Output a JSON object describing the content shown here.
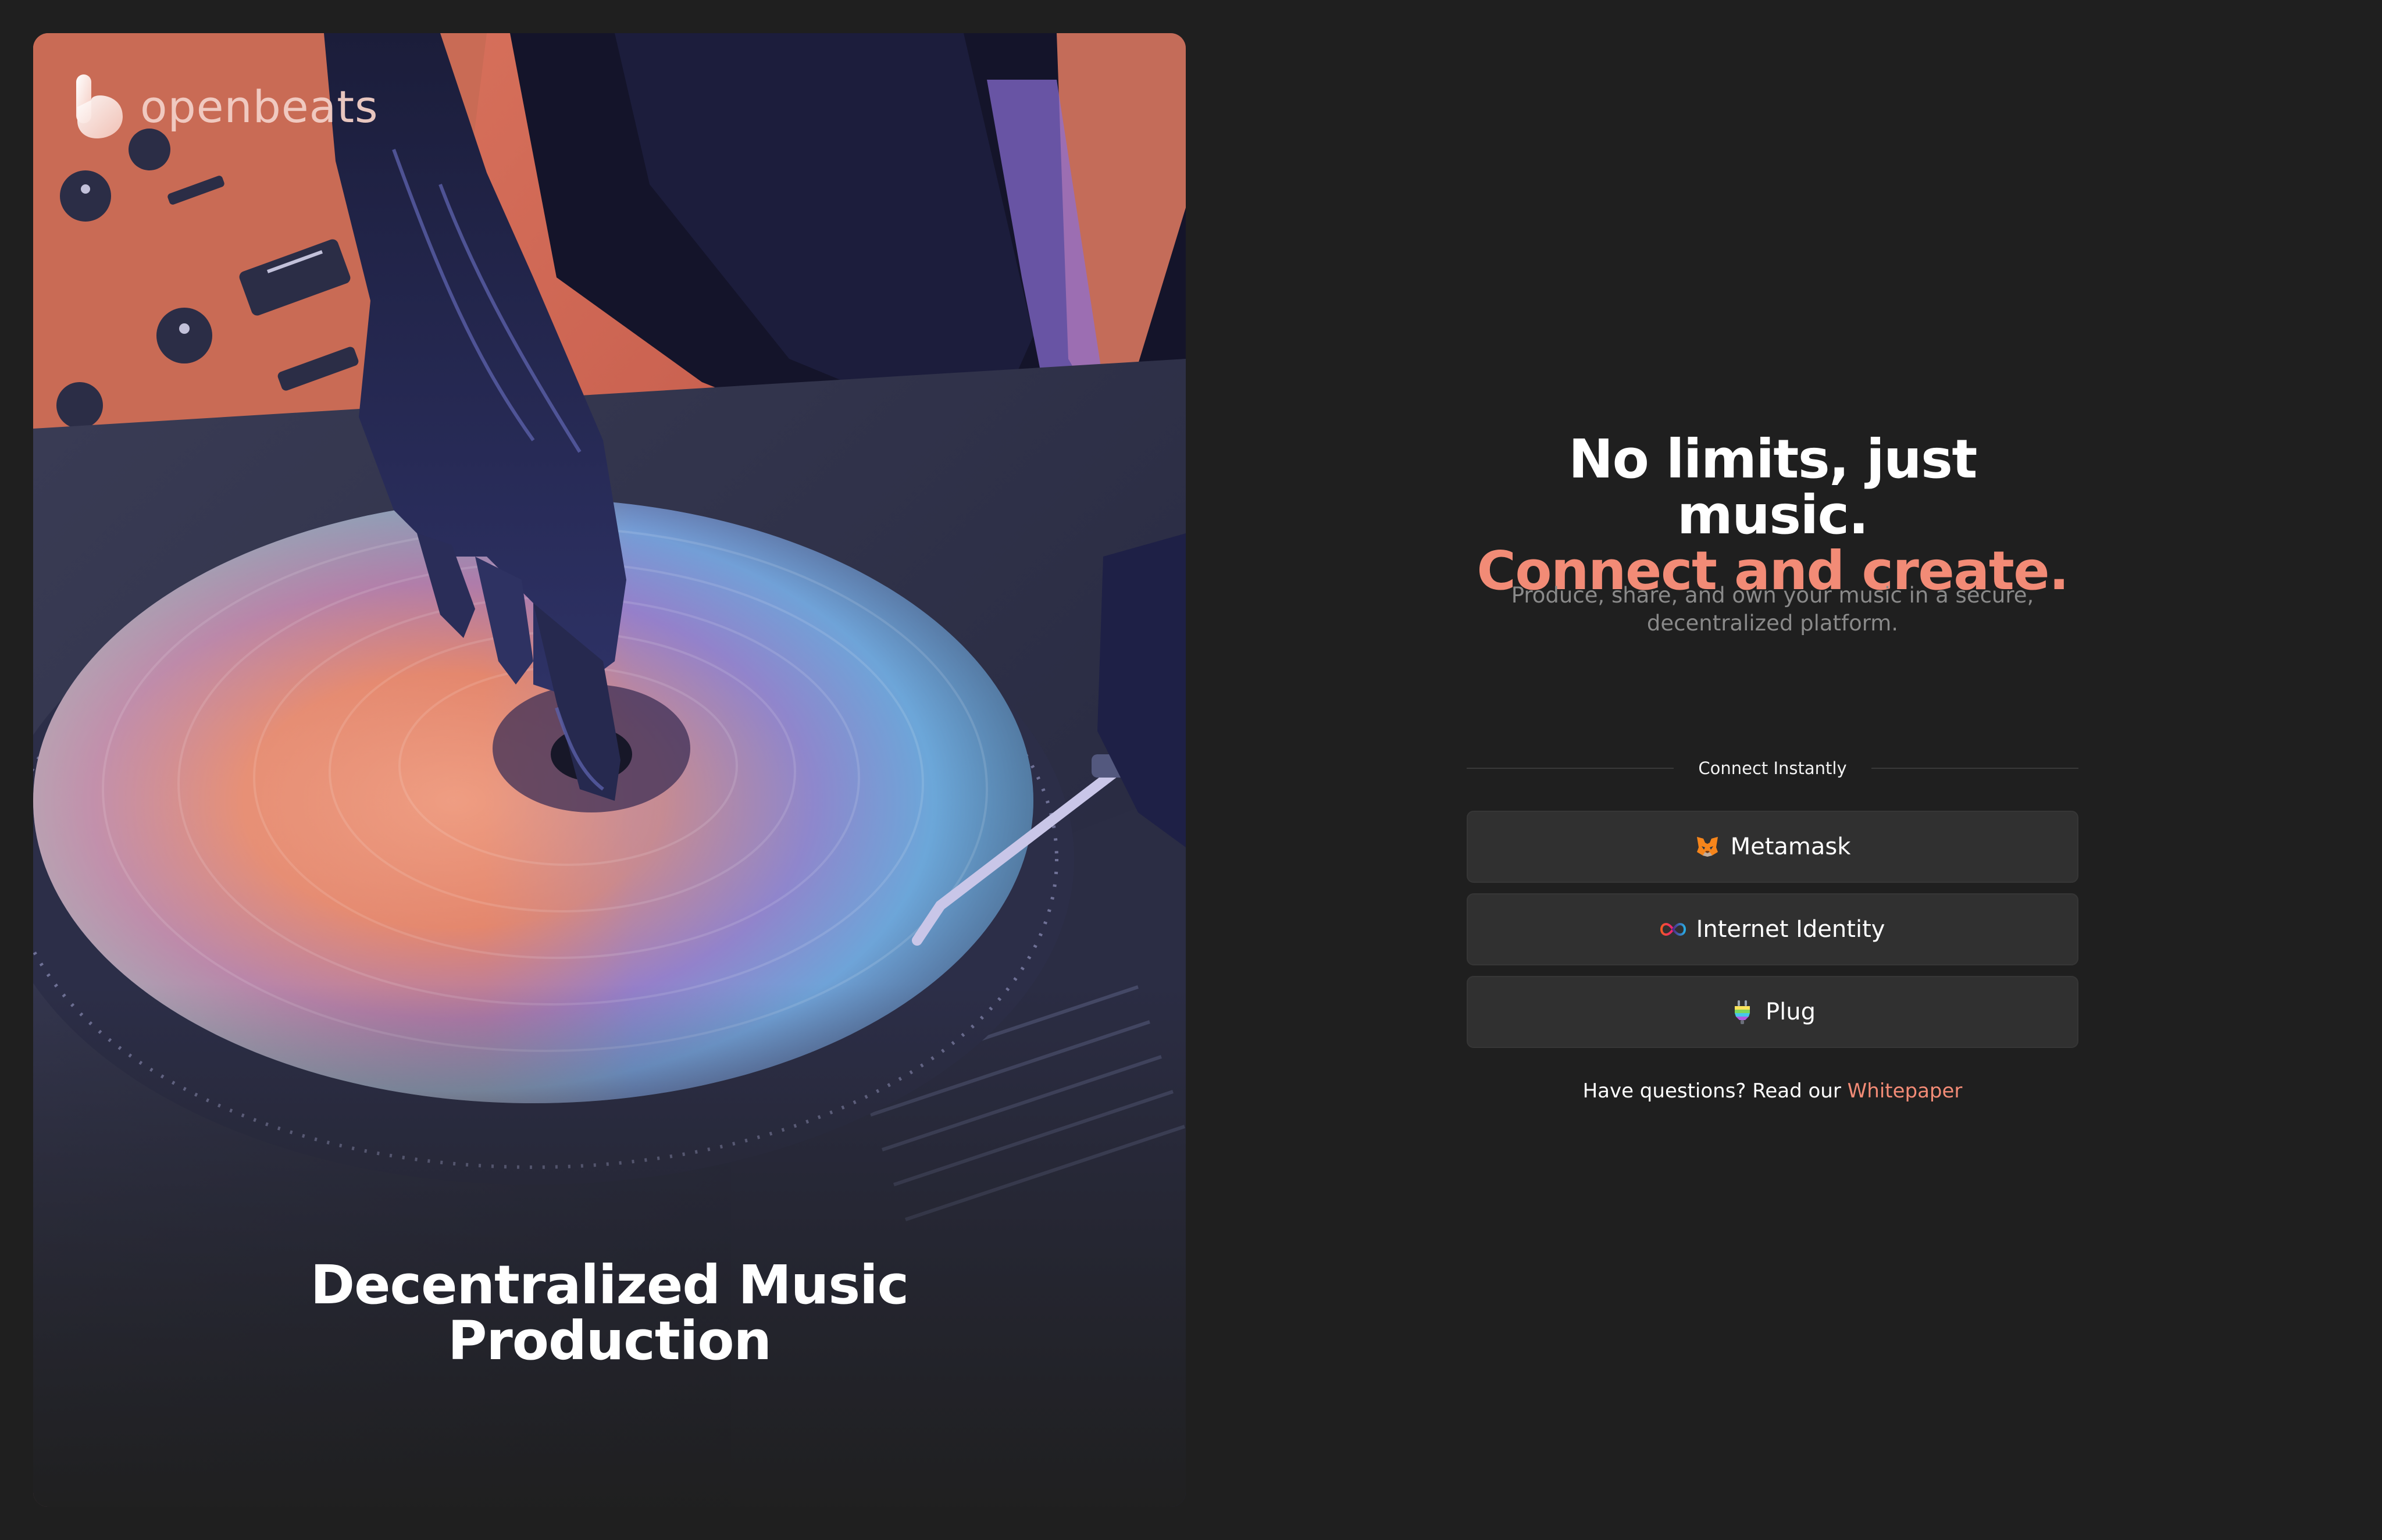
{
  "hero": {
    "brand_name": "openbeats",
    "logo_icon": "openbeats-logo-icon",
    "caption_line1": "Decentralized Music",
    "caption_line2": "Production",
    "image_subject": "dj-turntable-illustration"
  },
  "auth": {
    "headline_line1": "No limits, just music.",
    "headline_line2": "Connect and create.",
    "subtitle": "Produce, share, and own your music in a secure, decentralized platform.",
    "divider_label": "Connect Instantly",
    "buttons": [
      {
        "label": "Metamask",
        "icon": "metamask-fox-icon"
      },
      {
        "label": "Internet Identity",
        "icon": "infinity-icon"
      },
      {
        "label": "Plug",
        "icon": "plug-icon"
      }
    ],
    "footer_prefix": "Have questions? Read our",
    "footer_link": "Whitepaper"
  },
  "colors": {
    "background": "#1f1f1f",
    "accent": "#f28b76",
    "button_bg": "#303030",
    "muted_text": "#8a8a8a"
  }
}
